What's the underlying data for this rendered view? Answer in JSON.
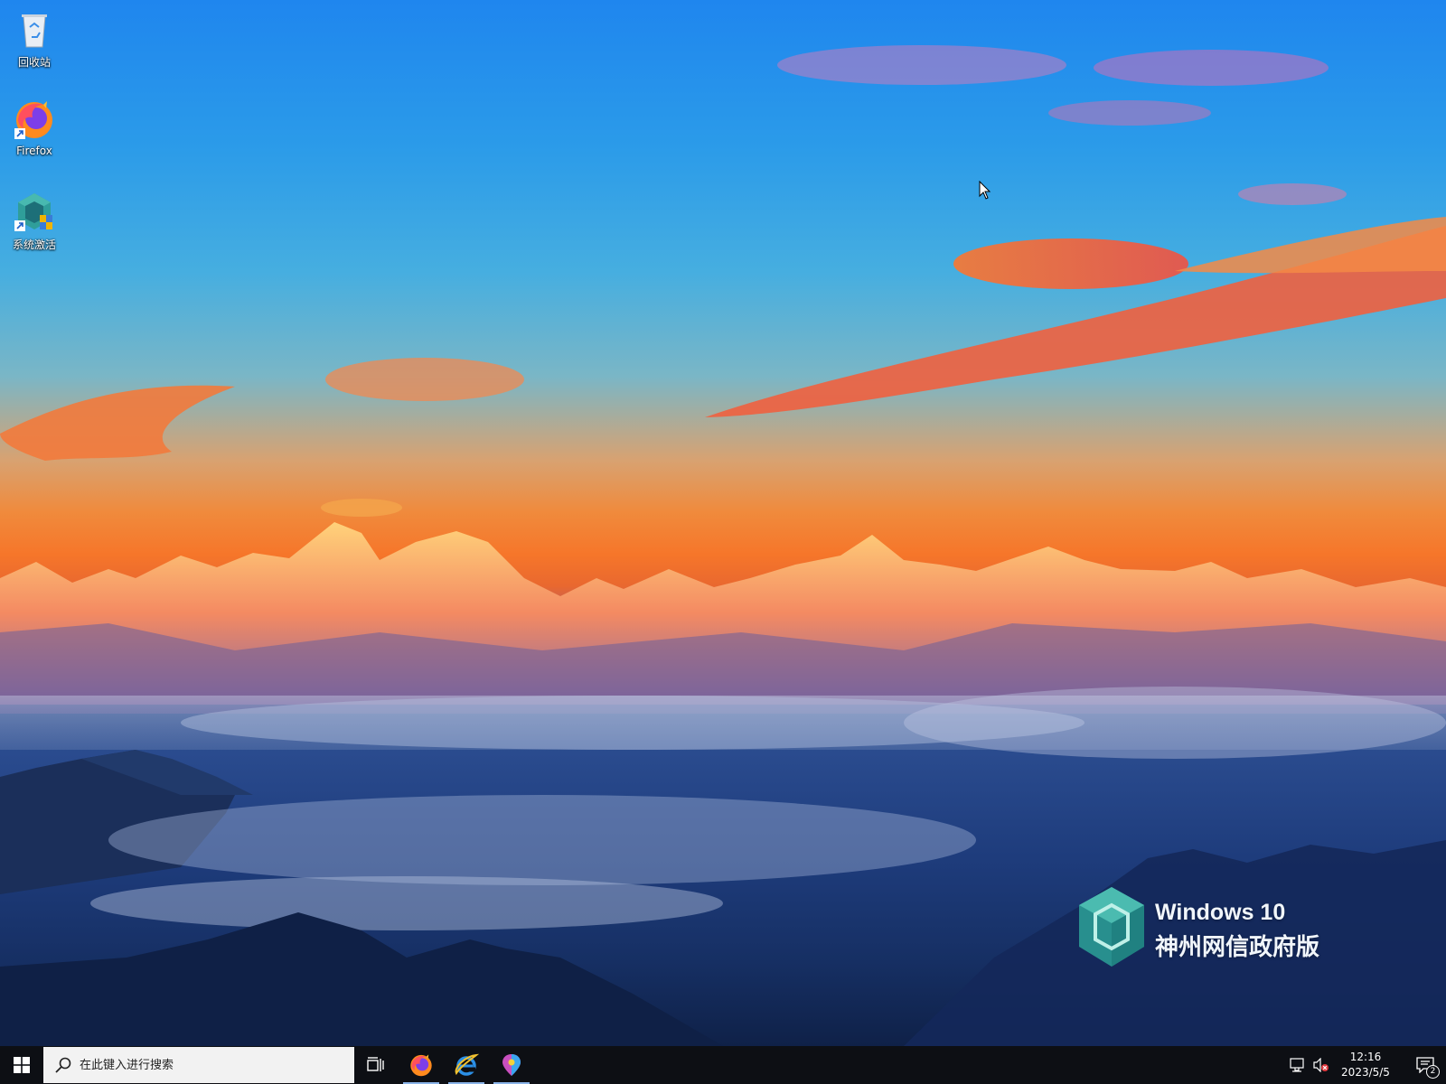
{
  "desktop": {
    "icons": [
      {
        "label": "回收站",
        "icon": "recycle-bin-icon"
      },
      {
        "label": "Firefox",
        "icon": "firefox-icon"
      },
      {
        "label": "系统激活",
        "icon": "system-activation-icon"
      }
    ],
    "watermark": {
      "line1": "Windows 10",
      "line2": "神州网信政府版"
    }
  },
  "taskbar": {
    "start_icon": "windows-logo-icon",
    "search": {
      "placeholder": "在此键入进行搜索",
      "value": ""
    },
    "task_view_icon": "task-view-icon",
    "pinned_apps": [
      {
        "name": "Firefox",
        "icon": "firefox-icon"
      },
      {
        "name": "Internet Explorer",
        "icon": "internet-explorer-icon"
      },
      {
        "name": "Maps",
        "icon": "maps-icon"
      }
    ],
    "tray": {
      "network_icon": "network-icon",
      "volume_icon": "volume-muted-icon",
      "time": "12:16",
      "date": "2023/5/5",
      "notification_count": "2"
    }
  },
  "colors": {
    "taskbar": "#0d0f14",
    "search_box": "#f2f2f2",
    "accent_underline": "#8ab4e8",
    "watermark_teal": "#2a9a93"
  }
}
